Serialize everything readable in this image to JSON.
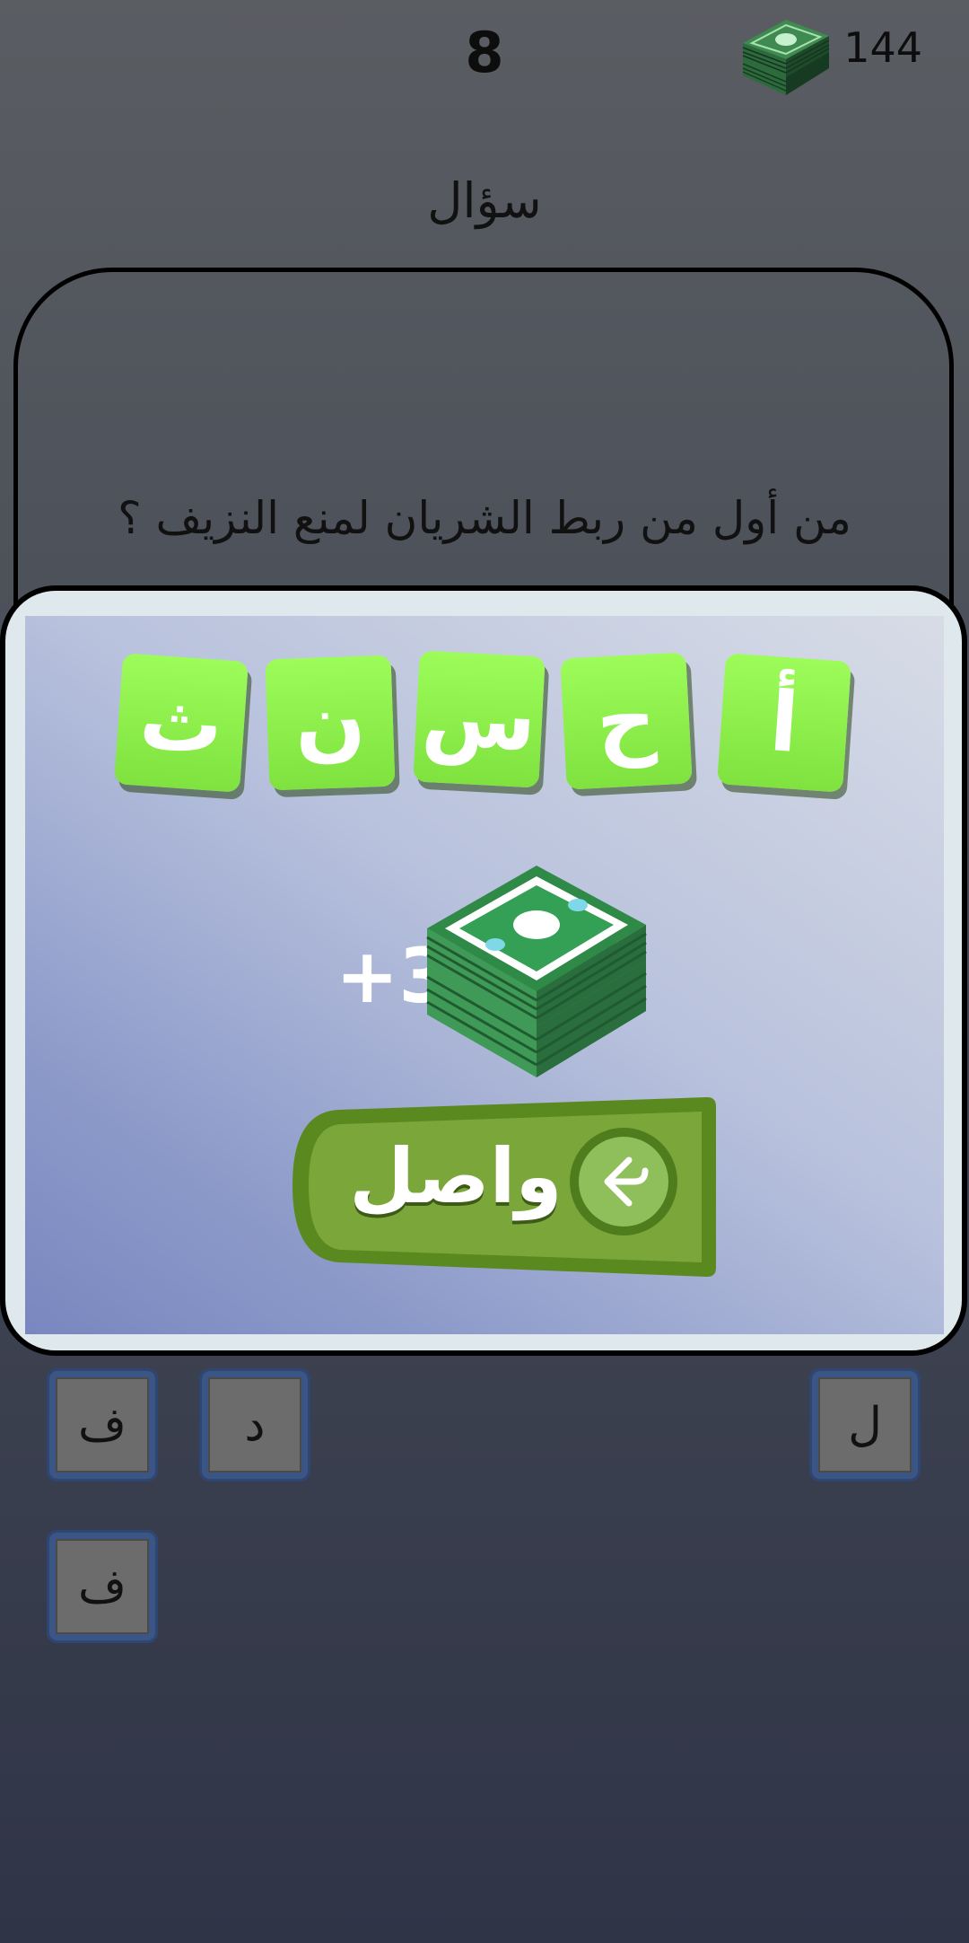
{
  "header": {
    "level": "8",
    "coins": "144",
    "cash_icon": "cash-stack-icon"
  },
  "question": {
    "title": "سؤال",
    "text": "من أول من ربط الشريان لمنع النزيف ؟"
  },
  "dialog": {
    "answer_tiles": [
      "ث",
      "ن",
      "س",
      "ح",
      "أ"
    ],
    "reward": "+3",
    "continue_label": "واصل",
    "continue_icon": "arrow-left-icon"
  },
  "keys": [
    "ف",
    "د",
    "ل",
    "ف"
  ],
  "colors": {
    "tile_green": "#8ff24c",
    "button_green": "#6c9a2c",
    "key_blue": "#3b5585",
    "key_face": "#6c6c6c"
  }
}
